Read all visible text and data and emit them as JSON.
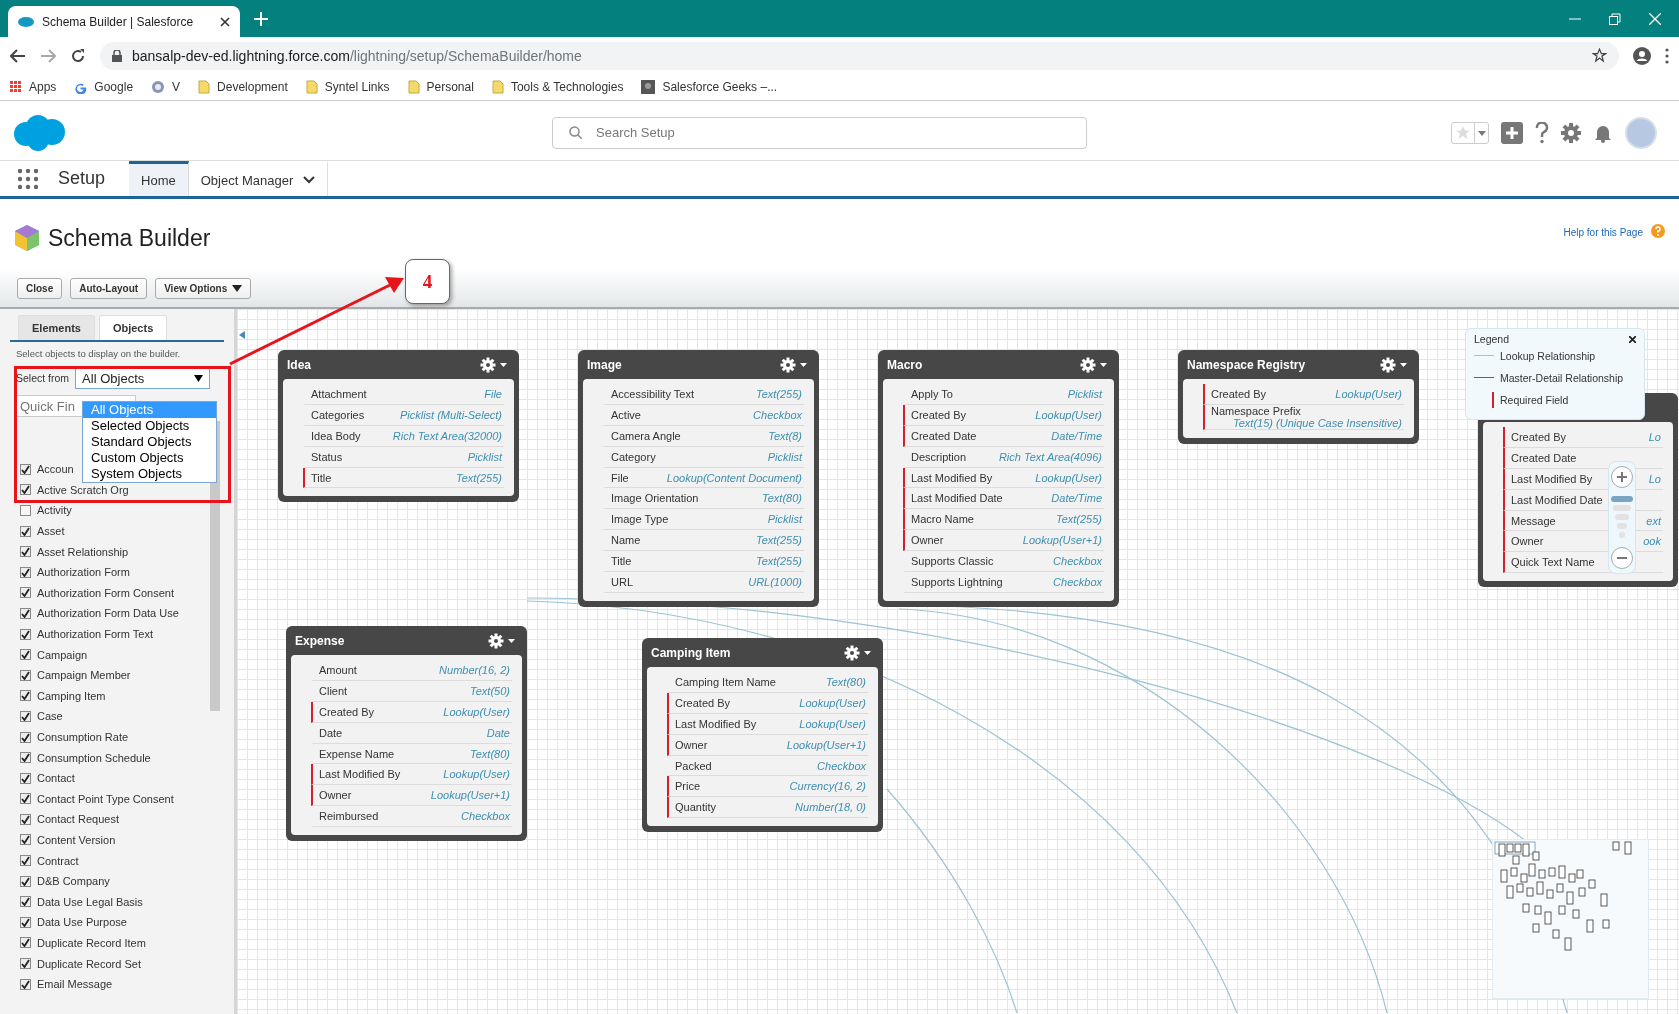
{
  "browser": {
    "tab_title": "Schema Builder | Salesforce",
    "url_host": "bansalp-dev-ed.lightning.force.com",
    "url_path": "/lightning/setup/SchemaBuilder/home",
    "bookmarks": [
      {
        "label": "Apps",
        "kind": "apps"
      },
      {
        "label": "Google",
        "kind": "google"
      },
      {
        "label": "V",
        "kind": "seal"
      },
      {
        "label": "Development",
        "kind": "folder"
      },
      {
        "label": "Syntel Links",
        "kind": "folder"
      },
      {
        "label": "Personal",
        "kind": "folder"
      },
      {
        "label": "Tools & Technologies",
        "kind": "folder"
      },
      {
        "label": "Salesforce Geeks –...",
        "kind": "photo"
      }
    ]
  },
  "header": {
    "search_placeholder": "Search Setup"
  },
  "nav": {
    "app_name": "Setup",
    "tabs": [
      {
        "label": "Home",
        "selected": true,
        "dropdown": false
      },
      {
        "label": "Object Manager",
        "selected": false,
        "dropdown": true
      }
    ]
  },
  "page": {
    "title": "Schema Builder",
    "help_link": "Help for this Page",
    "toolbar": [
      {
        "label": "Close",
        "kind": "plain"
      },
      {
        "label": "Auto-Layout",
        "kind": "plain"
      },
      {
        "label": "View Options",
        "kind": "menu"
      }
    ]
  },
  "sidebar": {
    "tabs": [
      {
        "label": "Elements",
        "selected": false
      },
      {
        "label": "Objects",
        "selected": true
      }
    ],
    "hint": "Select objects to display on the builder.",
    "select_label": "Select from",
    "select_value": "All Objects",
    "dropdown_options": [
      {
        "label": "All Objects",
        "selected": true
      },
      {
        "label": "Selected Objects",
        "selected": false
      },
      {
        "label": "Standard Objects",
        "selected": false
      },
      {
        "label": "Custom Objects",
        "selected": false
      },
      {
        "label": "System Objects",
        "selected": false
      }
    ],
    "quick_find_placeholder": "Quick Fin",
    "objects": [
      {
        "label": "Accoun",
        "checked": true
      },
      {
        "label": "Active Scratch Org",
        "checked": true
      },
      {
        "label": "Activity",
        "checked": false
      },
      {
        "label": "Asset",
        "checked": true
      },
      {
        "label": "Asset Relationship",
        "checked": true
      },
      {
        "label": "Authorization Form",
        "checked": true
      },
      {
        "label": "Authorization Form Consent",
        "checked": true
      },
      {
        "label": "Authorization Form Data Use",
        "checked": true
      },
      {
        "label": "Authorization Form Text",
        "checked": true
      },
      {
        "label": "Campaign",
        "checked": true
      },
      {
        "label": "Campaign Member",
        "checked": true
      },
      {
        "label": "Camping Item",
        "checked": true
      },
      {
        "label": "Case",
        "checked": true
      },
      {
        "label": "Consumption Rate",
        "checked": true
      },
      {
        "label": "Consumption Schedule",
        "checked": true
      },
      {
        "label": "Contact",
        "checked": true
      },
      {
        "label": "Contact Point Type Consent",
        "checked": true
      },
      {
        "label": "Contact Request",
        "checked": true
      },
      {
        "label": "Content Version",
        "checked": true
      },
      {
        "label": "Contract",
        "checked": true
      },
      {
        "label": "D&B Company",
        "checked": true
      },
      {
        "label": "Data Use Legal Basis",
        "checked": true
      },
      {
        "label": "Data Use Purpose",
        "checked": true
      },
      {
        "label": "Duplicate Record Item",
        "checked": true
      },
      {
        "label": "Duplicate Record Set",
        "checked": true
      },
      {
        "label": "Email Message",
        "checked": true
      }
    ]
  },
  "canvas": {
    "objects": [
      {
        "title": "Idea",
        "fields": [
          {
            "name": "Attachment",
            "type": "File",
            "required": false
          },
          {
            "name": "Categories",
            "type": "Picklist (Multi-Select)",
            "required": false
          },
          {
            "name": "Idea Body",
            "type": "Rich Text Area(32000)",
            "required": false
          },
          {
            "name": "Status",
            "type": "Picklist",
            "required": false
          },
          {
            "name": "Title",
            "type": "Text(255)",
            "required": true
          }
        ]
      },
      {
        "title": "Image",
        "fields": [
          {
            "name": "Accessibility Text",
            "type": "Text(255)",
            "required": false
          },
          {
            "name": "Active",
            "type": "Checkbox",
            "required": false
          },
          {
            "name": "Camera Angle",
            "type": "Text(8)",
            "required": false
          },
          {
            "name": "Category",
            "type": "Picklist",
            "required": false
          },
          {
            "name": "File",
            "type": "Lookup(Content Document)",
            "required": false
          },
          {
            "name": "Image Orientation",
            "type": "Text(80)",
            "required": false
          },
          {
            "name": "Image Type",
            "type": "Picklist",
            "required": false
          },
          {
            "name": "Name",
            "type": "Text(255)",
            "required": false
          },
          {
            "name": "Title",
            "type": "Text(255)",
            "required": false
          },
          {
            "name": "URL",
            "type": "URL(1000)",
            "required": false
          }
        ]
      },
      {
        "title": "Macro",
        "fields": [
          {
            "name": "Apply To",
            "type": "Picklist",
            "required": false
          },
          {
            "name": "Created By",
            "type": "Lookup(User)",
            "required": true
          },
          {
            "name": "Created Date",
            "type": "Date/Time",
            "required": true
          },
          {
            "name": "Description",
            "type": "Rich Text Area(4096)",
            "required": false
          },
          {
            "name": "Last Modified By",
            "type": "Lookup(User)",
            "required": true
          },
          {
            "name": "Last Modified Date",
            "type": "Date/Time",
            "required": true
          },
          {
            "name": "Macro Name",
            "type": "Text(255)",
            "required": true
          },
          {
            "name": "Owner",
            "type": "Lookup(User+1)",
            "required": true
          },
          {
            "name": "Supports Classic",
            "type": "Checkbox",
            "required": false
          },
          {
            "name": "Supports Lightning",
            "type": "Checkbox",
            "required": false
          }
        ]
      },
      {
        "title": "Namespace Registry",
        "fields": [
          {
            "name": "Created By",
            "type": "Lookup(User)",
            "required": true
          },
          {
            "name": "Namespace Prefix",
            "type": "Text(15) (Unique Case Insensitive)",
            "required": true
          }
        ]
      },
      {
        "fields": [
          {
            "name": "Created By",
            "type": "Lo",
            "required": true
          },
          {
            "name": "Created Date",
            "required": true
          },
          {
            "name": "Last Modified By",
            "type": "Lo",
            "required": true
          },
          {
            "name": "Last Modified Date",
            "required": true
          },
          {
            "name": "Message",
            "type": "ext",
            "required": true
          },
          {
            "name": "Owner",
            "type": "ook",
            "required": true
          },
          {
            "name": "Quick Text Name",
            "required": true
          }
        ]
      },
      {
        "title": "Expense",
        "fields": [
          {
            "name": "Amount",
            "type": "Number(16, 2)",
            "required": false
          },
          {
            "name": "Client",
            "type": "Text(50)",
            "required": false
          },
          {
            "name": "Created By",
            "type": "Lookup(User)",
            "required": true
          },
          {
            "name": "Date",
            "type": "Date",
            "required": false
          },
          {
            "name": "Expense Name",
            "type": "Text(80)",
            "required": false
          },
          {
            "name": "Last Modified By",
            "type": "Lookup(User)",
            "required": true
          },
          {
            "name": "Owner",
            "type": "Lookup(User+1)",
            "required": true
          },
          {
            "name": "Reimbursed",
            "type": "Checkbox",
            "required": false
          }
        ]
      },
      {
        "title": "Camping Item",
        "fields": [
          {
            "name": "Camping Item Name",
            "type": "Text(80)",
            "required": false
          },
          {
            "name": "Created By",
            "type": "Lookup(User)",
            "required": true
          },
          {
            "name": "Last Modified By",
            "type": "Lookup(User)",
            "required": true
          },
          {
            "name": "Owner",
            "type": "Lookup(User+1)",
            "required": true
          },
          {
            "name": "Packed",
            "type": "Checkbox",
            "required": false
          },
          {
            "name": "Price",
            "type": "Currency(16, 2)",
            "required": true
          },
          {
            "name": "Quantity",
            "type": "Number(18, 0)",
            "required": true
          }
        ]
      }
    ],
    "legend": {
      "title": "Legend",
      "items": [
        {
          "label": "Lookup Relationship",
          "kind": "lookup"
        },
        {
          "label": "Master-Detail Relationship",
          "kind": "master"
        },
        {
          "label": "Required Field",
          "kind": "required"
        }
      ]
    }
  },
  "annotation": {
    "callout": "4"
  }
}
